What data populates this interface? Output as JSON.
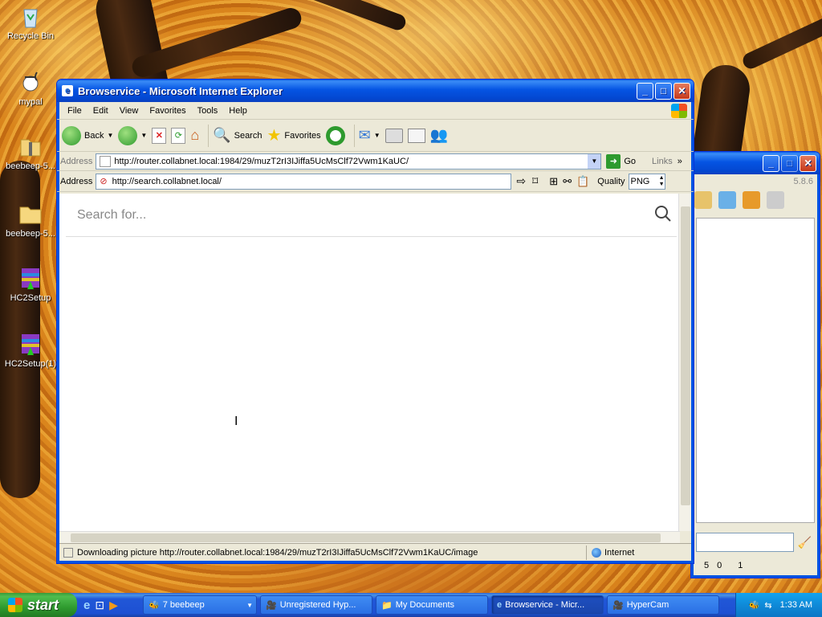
{
  "desktop": {
    "icons": [
      {
        "label": "Recycle Bin",
        "icon": "recycle-bin-icon"
      },
      {
        "label": "mypal",
        "icon": "mypal-icon"
      },
      {
        "label": "beebeep-5...",
        "icon": "zip-folder-icon"
      },
      {
        "label": "beebeep-5...",
        "icon": "folder-icon"
      },
      {
        "label": "HC2Setup",
        "icon": "winrar-installer-icon"
      },
      {
        "label": "HC2Setup(1)",
        "icon": "winrar-installer-icon"
      }
    ]
  },
  "ie": {
    "title": "Browservice - Microsoft Internet Explorer",
    "menu": [
      "File",
      "Edit",
      "View",
      "Favorites",
      "Tools",
      "Help"
    ],
    "toolbar": {
      "back": "Back",
      "search": "Search",
      "favorites": "Favorites"
    },
    "address": {
      "label": "Address",
      "url": "http://router.collabnet.local:1984/29/muzT2rI3IJiffa5UcMsClf72Vwm1KaUC/",
      "go": "Go",
      "links": "Links"
    },
    "bs_toolbar": {
      "label": "Address",
      "url": "http://search.collabnet.local/",
      "quality_label": "Quality",
      "quality_value": "PNG"
    },
    "page": {
      "search_placeholder": "Search for..."
    },
    "status": {
      "text": "Downloading picture http://router.collabnet.local:1984/29/muzT2rI3IJiffa5UcMsClf72Vwm1KaUC/image",
      "zone": "Internet"
    }
  },
  "beebeep": {
    "version": "5.8.6",
    "stats": [
      "5",
      "0",
      "",
      "1"
    ]
  },
  "taskbar": {
    "start": "start",
    "tasks": [
      {
        "label": "7 beebeep",
        "icon": "beebeep-icon"
      },
      {
        "label": "Unregistered Hyp...",
        "icon": "hypercam-icon"
      },
      {
        "label": "My Documents",
        "icon": "folder-icon"
      },
      {
        "label": "Browservice - Micr...",
        "icon": "ie-icon",
        "active": true
      },
      {
        "label": "HyperCam",
        "icon": "hypercam-icon"
      }
    ],
    "clock": "1:33 AM"
  },
  "colors": {
    "xp_blue": "#0054e3",
    "start_green": "#3a9a3a",
    "tray_blue": "#0f8ad8"
  }
}
